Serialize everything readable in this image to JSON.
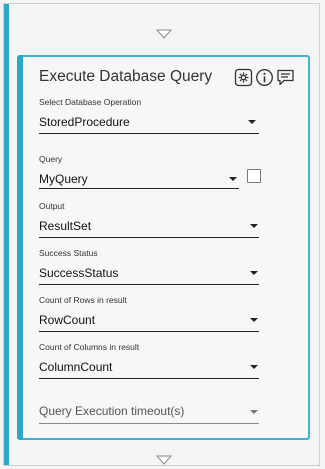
{
  "card": {
    "title": "Execute Database Query",
    "icons": [
      "settings-icon",
      "info-icon",
      "comment-icon"
    ]
  },
  "fields": {
    "operation": {
      "label": "Select Database Operation",
      "value": "StoredProcedure"
    },
    "query": {
      "label": "Query",
      "value": "MyQuery",
      "checkbox_checked": false
    },
    "output": {
      "label": "Output",
      "value": "ResultSet"
    },
    "success_status": {
      "label": "Success Status",
      "value": "SuccessStatus"
    },
    "row_count": {
      "label": "Count of Rows in result",
      "value": "RowCount"
    },
    "column_count": {
      "label": "Count of Columns in result",
      "value": "ColumnCount"
    },
    "timeout": {
      "placeholder": "Query Execution timeout(s)"
    }
  },
  "colors": {
    "accent": "#2fa7c8",
    "card_border": "#3fb1d2"
  }
}
